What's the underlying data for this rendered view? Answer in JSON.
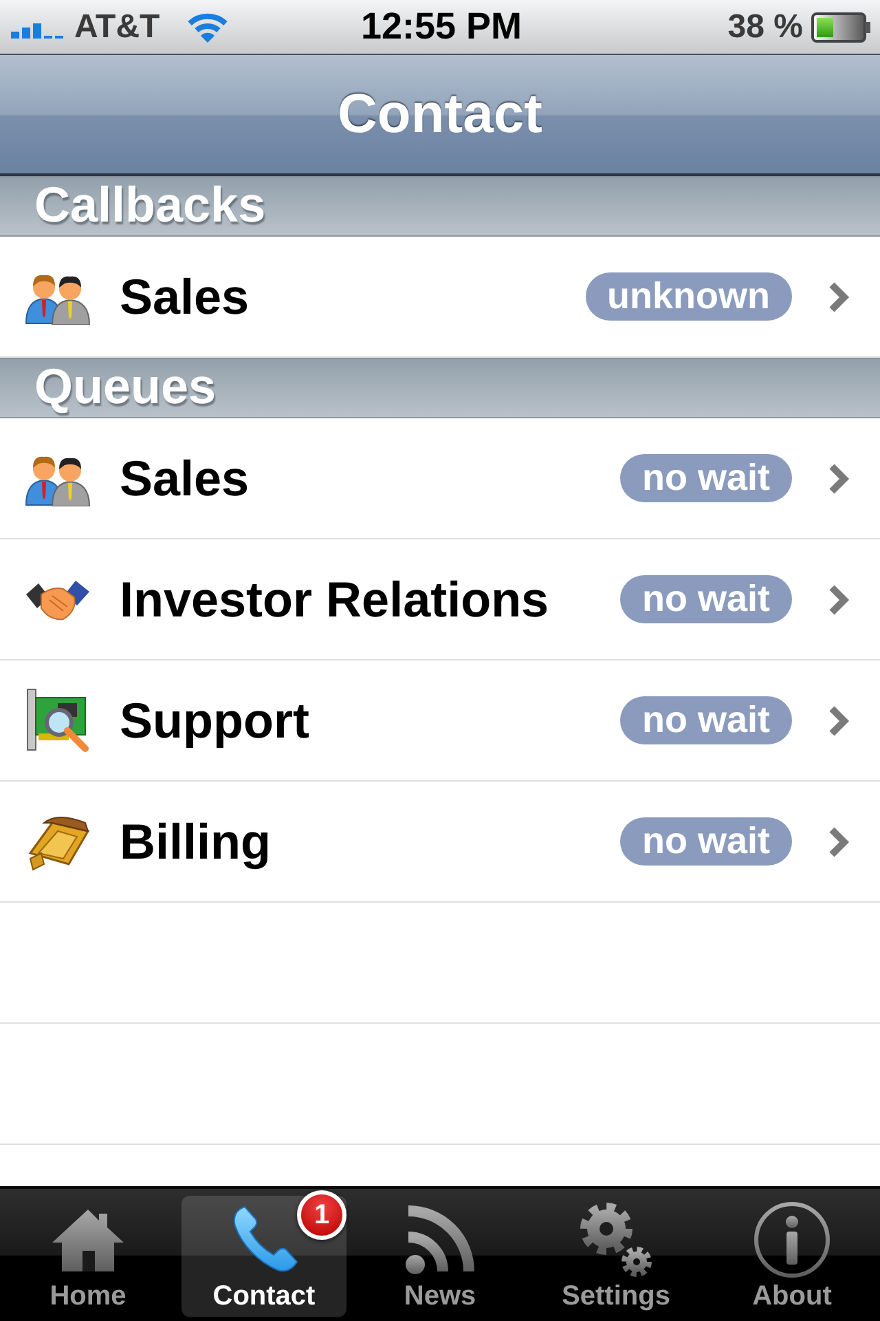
{
  "status_bar": {
    "carrier": "AT&T",
    "time": "12:55 PM",
    "battery": "38 %"
  },
  "nav_bar": {
    "title": "Contact"
  },
  "sections": [
    {
      "title": "Callbacks",
      "rows": [
        {
          "kind": "people",
          "label": "Sales",
          "wait": "unknown"
        }
      ]
    },
    {
      "title": "Queues",
      "rows": [
        {
          "kind": "people",
          "label": "Sales",
          "wait": "no wait"
        },
        {
          "kind": "handshake",
          "label": "Investor Relations",
          "wait": "no wait"
        },
        {
          "kind": "card",
          "label": "Support",
          "wait": "no wait"
        },
        {
          "kind": "wallet",
          "label": "Billing",
          "wait": "no wait"
        }
      ]
    }
  ],
  "tab_bar": {
    "tabs": [
      {
        "kind": "home",
        "label": "Home",
        "selected": false
      },
      {
        "kind": "phone",
        "label": "Contact",
        "selected": true,
        "badge": "1"
      },
      {
        "kind": "rss",
        "label": "News",
        "selected": false
      },
      {
        "kind": "gears",
        "label": "Settings",
        "selected": false
      },
      {
        "kind": "info",
        "label": "About",
        "selected": false
      }
    ]
  }
}
